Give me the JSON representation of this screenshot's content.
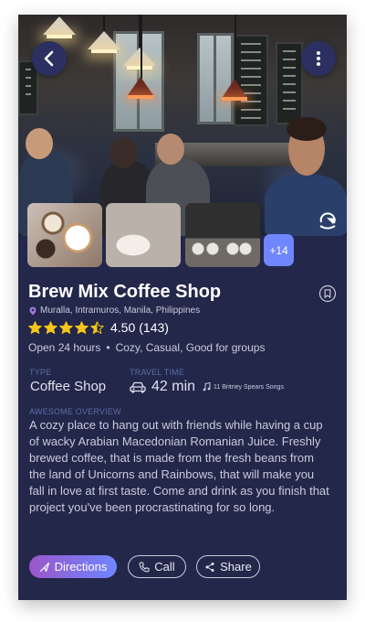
{
  "place": {
    "title": "Brew Mix Coffee Shop",
    "address": "Muralla, Intramuros, Manila, Philippines",
    "rating": {
      "value": "4.50",
      "count": "(143)",
      "stars": 4.5,
      "max": 5
    },
    "hours": "Open 24 hours",
    "tags": "Cozy, Casual, Good for groups"
  },
  "gallery": {
    "more_label": "+14"
  },
  "details": {
    "type_label": "TYPE",
    "type_value": "Coffee Shop",
    "travel_label": "TRAVEL TIME",
    "travel_value": "42 min",
    "song_text": "11 Britney Spears Songs",
    "overview_label": "AWESOME OVERVIEW",
    "overview_text": "A cozy place to hang out with friends while having a cup of wacky Arabian Macedonian Romanian Juice. Freshly brewed coffee, that is made from the fresh beans from the land of Unicorns and Rainbows, that will make you fall in love at first taste. Come and drink as you finish that project you've been procrastinating for so long."
  },
  "actions": {
    "directions": "Directions",
    "call": "Call",
    "share": "Share"
  },
  "icons": {
    "back": "chevron-left-icon",
    "more": "more-vertical-icon",
    "rotate": "rotate-360-icon",
    "bookmark": "bookmark-icon",
    "location": "location-pin-icon",
    "star": "star-icon",
    "car": "car-icon",
    "music": "music-note-icon",
    "directions": "navigation-arrow-icon",
    "call": "phone-icon",
    "share": "share-icon"
  },
  "colors": {
    "card_bg": "#23274a",
    "accent_blue": "#6f86ff",
    "accent_purple": "#9b56c9",
    "star": "#f5c518",
    "muted_label": "#5b6ca8"
  }
}
